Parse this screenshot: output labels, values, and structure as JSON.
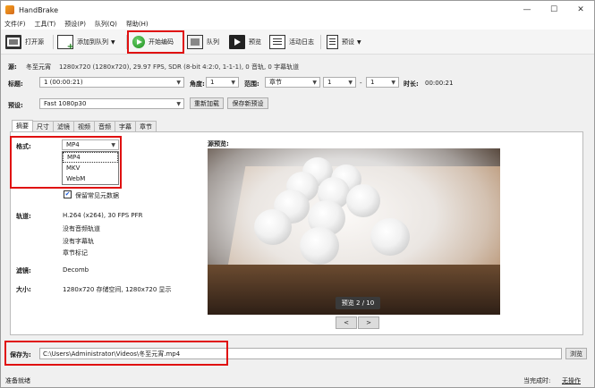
{
  "window": {
    "title": "HandBrake",
    "minimize": "—",
    "maximize": "☐",
    "close": "✕"
  },
  "menu": [
    "文件(F)",
    "工具(T)",
    "预设(P)",
    "队列(Q)",
    "帮助(H)"
  ],
  "toolbar": {
    "open_source": "打开源",
    "add_to_queue": "添加到队列",
    "start_encode": "开始编码",
    "queue": "队列",
    "preview": "预览",
    "activity_log": "活动日志",
    "presets": "预设"
  },
  "source": {
    "label": "源:",
    "name": "冬至元宵",
    "info": "1280x720 (1280x720), 29.97 FPS, SDR (8-bit 4:2:0, 1-1-1), 0 音轨, 0 字幕轨道"
  },
  "title_row": {
    "title_label": "标题:",
    "title_value": "1 (00:00:21)",
    "angle_label": "角度:",
    "angle_value": "1",
    "range_label": "范围:",
    "range_type": "章节",
    "range_start": "1",
    "range_dash": "-",
    "range_end": "1",
    "duration_label": "时长:",
    "duration_value": "00:00:21"
  },
  "preset_row": {
    "label": "预设:",
    "value": "Fast 1080p30",
    "reload": "重新加载",
    "save_new": "保存新预设"
  },
  "tabs": [
    "摘要",
    "尺寸",
    "滤镜",
    "视频",
    "音频",
    "字幕",
    "章节"
  ],
  "summary": {
    "format_label": "格式:",
    "format_value": "MP4",
    "format_options": [
      "MP4",
      "MKV",
      "WebM"
    ],
    "keep_metadata": "保留常见元数据",
    "keep_metadata_check": "✔",
    "tracks_label": "轨道:",
    "tracks": [
      "H.264 (x264), 30 FPS PFR",
      "没有音频轨道",
      "没有字幕轨",
      "章节标记"
    ],
    "filters_label": "滤镜:",
    "filters_value": "Decomb",
    "size_label": "大小:",
    "size_value": "1280x720 存储空间, 1280x720 显示"
  },
  "preview": {
    "label": "源预览:",
    "badge": "预览 2 / 10",
    "prev": "<",
    "next": ">"
  },
  "save": {
    "label": "保存为:",
    "path": "C:\\Users\\Administrator\\Videos\\冬至元宵.mp4",
    "browse": "浏览"
  },
  "status": {
    "left": "准备就绪",
    "when_done_label": "当完成时:",
    "when_done_value": "无操作"
  },
  "colors": {
    "highlight": "#e01010",
    "check": "#1a5ad8",
    "play": "#1d8f1d"
  }
}
